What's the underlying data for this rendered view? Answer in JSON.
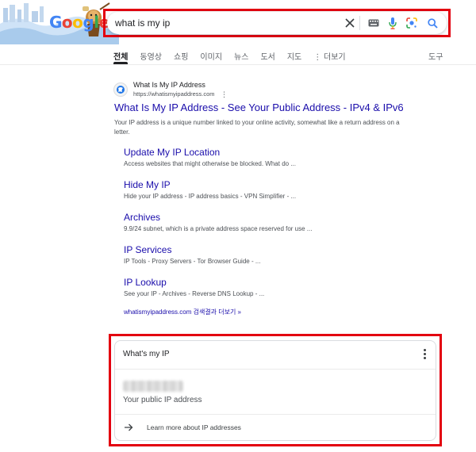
{
  "logo": {
    "text": "Google"
  },
  "search": {
    "query": "what is my ip"
  },
  "tabs": [
    {
      "label": "전체",
      "active": true
    },
    {
      "label": "동영상"
    },
    {
      "label": "쇼핑"
    },
    {
      "label": "이미지"
    },
    {
      "label": "뉴스"
    },
    {
      "label": "도서"
    },
    {
      "label": "지도"
    },
    {
      "label": "⋮ 더보기"
    }
  ],
  "tools_label": "도구",
  "result": {
    "site_name": "What Is My IP Address",
    "site_url": "https://whatismyipaddress.com",
    "title": "What Is My IP Address - See Your Public Address - IPv4 & IPv6",
    "snippet_bold": "Your IP",
    "snippet_rest": " address is a unique number linked to your online activity, somewhat like a return address on a letter.",
    "sitelinks": [
      {
        "title": "Update My IP Location",
        "desc": "Access websites that might otherwise be blocked. What do ..."
      },
      {
        "title": "Hide My IP",
        "desc": "Hide your IP address - IP address basics - VPN Simplifier - ..."
      },
      {
        "title": "Archives",
        "desc": "9.9/24 subnet, which is a private address space reserved for use ..."
      },
      {
        "title": "IP Services",
        "desc": "IP Tools - Proxy Servers - Tor Browser Guide - ..."
      },
      {
        "title": "IP Lookup",
        "desc": "See your IP - Archives - Reverse DNS Lookup - ..."
      }
    ],
    "more_results": "whatismyipaddress.com 검색결과 더보기 »"
  },
  "ip_card": {
    "title": "What's my IP",
    "ip_label": "Your public IP address",
    "learn_more": "Learn more about IP addresses"
  },
  "colors": {
    "link": "#1a0dab",
    "highlight": "#e3000f",
    "google_blue": "#4285f4",
    "google_red": "#ea4335",
    "google_yellow": "#fbbc05",
    "google_green": "#34a853"
  }
}
